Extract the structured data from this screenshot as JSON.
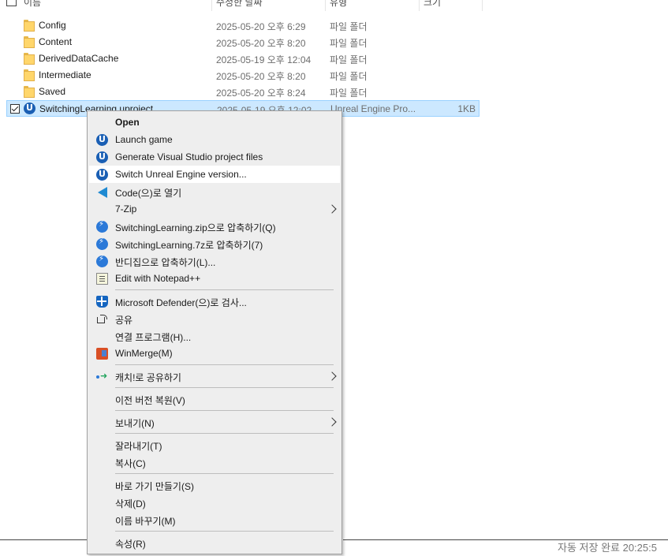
{
  "header": {
    "col_name": "이름",
    "col_date": "수정한 날짜",
    "col_type": "유형",
    "col_size": "크기"
  },
  "files": [
    {
      "name": "Config",
      "date": "2025-05-20 오후 6:29",
      "type": "파일 폴더",
      "size": ""
    },
    {
      "name": "Content",
      "date": "2025-05-20 오후 8:20",
      "type": "파일 폴더",
      "size": ""
    },
    {
      "name": "DerivedDataCache",
      "date": "2025-05-19 오후 12:04",
      "type": "파일 폴더",
      "size": ""
    },
    {
      "name": "Intermediate",
      "date": "2025-05-20 오후 8:20",
      "type": "파일 폴더",
      "size": ""
    },
    {
      "name": "Saved",
      "date": "2025-05-20 오후 8:24",
      "type": "파일 폴더",
      "size": ""
    },
    {
      "name": "SwitchingLearning.uproject",
      "date": "2025-05-19 오후 12:02",
      "type": "Unreal Engine Pro...",
      "size": "1KB"
    }
  ],
  "context_menu": {
    "items": [
      {
        "label": "Open",
        "icon": "none"
      },
      {
        "label": "Launch game",
        "icon": "unreal-icon"
      },
      {
        "label": "Generate Visual Studio project files",
        "icon": "unreal-icon"
      },
      {
        "label": "Switch Unreal Engine version...",
        "icon": "unreal-icon"
      },
      {
        "label": "Code(으)로 열기",
        "icon": "vscode-icon"
      },
      {
        "label": "7-Zip",
        "icon": "none",
        "submenu": true
      },
      {
        "label": "SwitchingLearning.zip으로 압축하기(Q)",
        "icon": "bandizip-icon"
      },
      {
        "label": "SwitchingLearning.7z로 압축하기(7)",
        "icon": "bandizip-icon"
      },
      {
        "label": "반디집으로 압축하기(L)...",
        "icon": "bandizip-icon"
      },
      {
        "label": "Edit with Notepad++",
        "icon": "notepad-icon"
      },
      {
        "label": "Microsoft Defender(으)로 검사...",
        "icon": "defender-icon"
      },
      {
        "label": "공유",
        "icon": "share-icon"
      },
      {
        "label": "연결 프로그램(H)...",
        "icon": "none"
      },
      {
        "label": "WinMerge(M)",
        "icon": "winmerge-icon"
      },
      {
        "label": "캐치!로 공유하기",
        "icon": "capture-icon",
        "submenu": true
      },
      {
        "label": "이전 버전 복원(V)",
        "icon": "none"
      },
      {
        "label": "보내기(N)",
        "icon": "none",
        "submenu": true
      },
      {
        "label": "잘라내기(T)",
        "icon": "none"
      },
      {
        "label": "복사(C)",
        "icon": "none"
      },
      {
        "label": "바로 가기 만들기(S)",
        "icon": "none"
      },
      {
        "label": "삭제(D)",
        "icon": "none"
      },
      {
        "label": "이름 바꾸기(M)",
        "icon": "none"
      },
      {
        "label": "속성(R)",
        "icon": "none"
      }
    ]
  },
  "status": {
    "autosave": "자동 저장 완료 20:25:5"
  }
}
